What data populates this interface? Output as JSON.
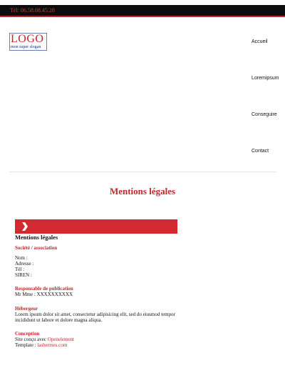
{
  "header": {
    "phone": "Tél: 06.58.08.45.28"
  },
  "logo": {
    "text": "LOGO",
    "slogan": "mon super slogan"
  },
  "nav": {
    "items": [
      "Accueil",
      "Loremipsum",
      "Conseguire",
      "Contact"
    ]
  },
  "page": {
    "title": "Mentions légales"
  },
  "legal": {
    "heading": "Mentions légales",
    "company_section": "Société / association",
    "name_label": "Nom :",
    "address_label": "Adresse :",
    "phone_label": "Tél :",
    "siren_label": "SIREN :",
    "publisher_section": "Responsable de publication",
    "publisher_value": "Mr Mme : XXXXXXXXXX",
    "host_section": "Hébergeur",
    "host_text": "Lorem ipsum dolor sit amet, consectetur adipisicing elit, sed do eiusmod tempor incididunt ut labore et dolore magna aliqua.",
    "design_section": "Conception",
    "design_prefix": "Site conçu avec",
    "design_link": "Openelement",
    "template_prefix": "Template :",
    "template_link": "lashermes.com"
  },
  "colors": {
    "accent": "#c1272d",
    "banner": "#d32a2f",
    "topbar": "#0c0c0c"
  }
}
